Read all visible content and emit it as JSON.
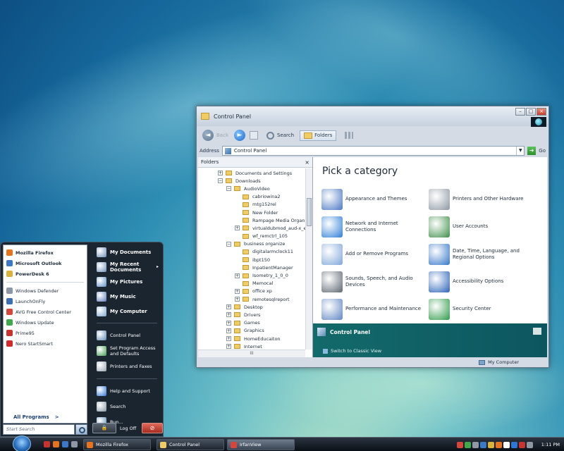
{
  "window": {
    "title": "Control Panel",
    "toolbar": {
      "back": "Back",
      "search": "Search",
      "folders": "Folders"
    },
    "address": {
      "label": "Address",
      "value": "Control Panel",
      "go": "Go"
    },
    "folders_pane": {
      "title": "Folders",
      "close": "×",
      "scroll_marker": "III",
      "tree": [
        {
          "label": "Documents and Settings",
          "indent": 0,
          "expander": "+"
        },
        {
          "label": "Downloads",
          "indent": 0,
          "expander": "−"
        },
        {
          "label": "AudioVideo",
          "indent": 1,
          "expander": "−"
        },
        {
          "label": "cabriowina2",
          "indent": 2,
          "expander": ""
        },
        {
          "label": "mtg152rel",
          "indent": 2,
          "expander": ""
        },
        {
          "label": "New Folder",
          "indent": 2,
          "expander": ""
        },
        {
          "label": "Rampage Media Organize",
          "indent": 2,
          "expander": ""
        },
        {
          "label": "virtualdubmod_aud-x_ena",
          "indent": 2,
          "expander": "+"
        },
        {
          "label": "wf_remctrl_105",
          "indent": 2,
          "expander": ""
        },
        {
          "label": "business organize",
          "indent": 1,
          "expander": "−"
        },
        {
          "label": "digitalarmclock11",
          "indent": 2,
          "expander": ""
        },
        {
          "label": "ibpt150",
          "indent": 2,
          "expander": ""
        },
        {
          "label": "InpatientManager",
          "indent": 2,
          "expander": ""
        },
        {
          "label": "Isometry_1_0_0",
          "indent": 2,
          "expander": "+"
        },
        {
          "label": "Memocal",
          "indent": 2,
          "expander": ""
        },
        {
          "label": "office xp",
          "indent": 2,
          "expander": "+"
        },
        {
          "label": "remotesqlreport",
          "indent": 2,
          "expander": "+"
        },
        {
          "label": "Desktop",
          "indent": 1,
          "expander": "+"
        },
        {
          "label": "Drivers",
          "indent": 1,
          "expander": "+"
        },
        {
          "label": "Games",
          "indent": 1,
          "expander": "+"
        },
        {
          "label": "Graphics",
          "indent": 1,
          "expander": "+"
        },
        {
          "label": "HomeEducaiton",
          "indent": 1,
          "expander": "+"
        },
        {
          "label": "Internet",
          "indent": 1,
          "expander": "+"
        }
      ]
    },
    "main": {
      "heading": "Pick a category",
      "categories": [
        {
          "label": "Appearance and Themes",
          "icon": "appearance-icon",
          "color": "#4a78c4"
        },
        {
          "label": "Printers and Other Hardware",
          "icon": "printer-icon",
          "color": "#8c97a3"
        },
        {
          "label": "Network and Internet Connections",
          "icon": "network-icon",
          "color": "#2f7fd6"
        },
        {
          "label": "User Accounts",
          "icon": "user-accounts-icon",
          "color": "#3f8f4a"
        },
        {
          "label": "Add or Remove Programs",
          "icon": "programs-icon",
          "color": "#7ea6d8"
        },
        {
          "label": "Date, Time, Language, and Regional Options",
          "icon": "globe-icon",
          "color": "#3576c9"
        },
        {
          "label": "Sounds, Speech, and Audio Devices",
          "icon": "speaker-icon",
          "color": "#5c6670"
        },
        {
          "label": "Accessibility Options",
          "icon": "accessibility-icon",
          "color": "#2a62b8"
        },
        {
          "label": "Performance and Maintenance",
          "icon": "performance-icon",
          "color": "#5f86c2"
        },
        {
          "label": "Security Center",
          "icon": "shield-icon",
          "color": "#2f9a4a"
        }
      ],
      "panel": {
        "title": "Control Panel",
        "switch": "Switch to Classic View"
      }
    },
    "status": "My Computer"
  },
  "start_menu": {
    "pinned": [
      {
        "label": "Mozilla Firefox",
        "color": "#e8731d"
      },
      {
        "label": "Microsoft Outlook",
        "color": "#3a79c8"
      },
      {
        "label": "PowerDesk 6",
        "color": "#d9b23a"
      }
    ],
    "recent": [
      {
        "label": "Windows Defender",
        "color": "#8d98a4"
      },
      {
        "label": "LaunchOnFly",
        "color": "#3a6fb3"
      },
      {
        "label": "AVG Free Control Center",
        "color": "#d7463a"
      },
      {
        "label": "Windows Update",
        "color": "#3fa84a"
      },
      {
        "label": "Prime95",
        "color": "#c8332d"
      },
      {
        "label": "Nero StartSmart",
        "color": "#d02a2a"
      }
    ],
    "all_programs": "All Programs",
    "all_programs_arrow": ">",
    "search_placeholder": "Start Search",
    "right": [
      {
        "label": "My Documents",
        "color": "#6f8fb8",
        "arrow": "",
        "style": "",
        "group": 1
      },
      {
        "label": "My Recent Documents",
        "color": "#6f8fb8",
        "arrow": "▸",
        "style": "",
        "group": 1
      },
      {
        "label": "My Pictures",
        "color": "#5c8fc4",
        "arrow": "",
        "style": "",
        "group": 1
      },
      {
        "label": "My Music",
        "color": "#5c7eb8",
        "arrow": "",
        "style": "",
        "group": 1
      },
      {
        "label": "My Computer",
        "color": "#7fa6cf",
        "arrow": "",
        "style": "",
        "group": 1
      },
      {
        "label": "Control Panel",
        "color": "#5d89b6",
        "arrow": "",
        "style": "small",
        "group": 2
      },
      {
        "label": "Set Program Access and Defaults",
        "color": "#3f9d4c",
        "arrow": "",
        "style": "small",
        "group": 2
      },
      {
        "label": "Printers and Faxes",
        "color": "#9aa4af",
        "arrow": "",
        "style": "small",
        "group": 2
      },
      {
        "label": "Help and Support",
        "color": "#2f76d2",
        "arrow": "",
        "style": "small",
        "group": 3
      },
      {
        "label": "Search",
        "color": "#8795a3",
        "arrow": "",
        "style": "small",
        "group": 3
      },
      {
        "label": "Run...",
        "color": "#5d89b6",
        "arrow": "",
        "style": "small",
        "group": 3
      }
    ],
    "lock": "🔒",
    "log_off": "Log Off",
    "power": "⊘"
  },
  "taskbar": {
    "tasks": [
      {
        "label": "Mozilla Firefox",
        "color": "#e8731d",
        "active": false
      },
      {
        "label": "Control Panel",
        "color": "#f1cc63",
        "active": false
      },
      {
        "label": "IrfanView",
        "color": "#d7463a",
        "active": true
      }
    ],
    "quick_launch": [
      "#c8332d",
      "#e8731d",
      "#3a79c8",
      "#8d98a4"
    ],
    "tray_colors": [
      "#d7463a",
      "#3fa84a",
      "#8d98a4",
      "#3a79c8",
      "#d9b23a",
      "#e8731d",
      "#ffffff",
      "#2f76d2",
      "#c8332d",
      "#8d98a4"
    ],
    "clock": "1:11 PM"
  }
}
